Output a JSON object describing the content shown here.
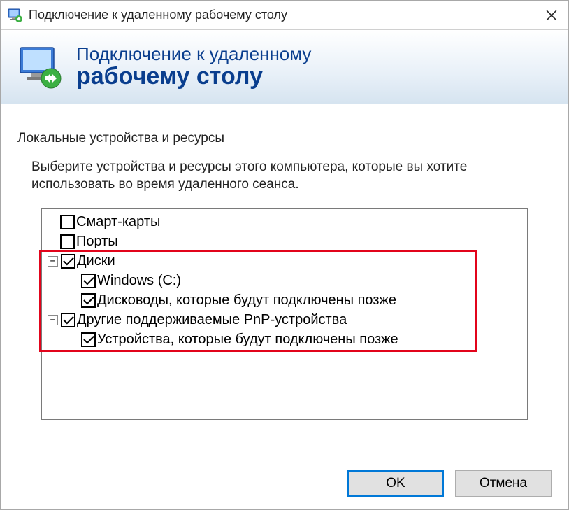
{
  "titlebar": {
    "title": "Подключение к удаленному рабочему столу"
  },
  "banner": {
    "line1": "Подключение к удаленному",
    "line2": "рабочему столу"
  },
  "section": {
    "title": "Локальные устройства и ресурсы",
    "instructions": "Выберите устройства и ресурсы этого компьютера, которые вы хотите использовать во время удаленного сеанса."
  },
  "tree": {
    "smartcards": "Смарт-карты",
    "ports": "Порты",
    "drives": "Диски",
    "windows_c": "Windows (C:)",
    "drives_later": "Дисководы, которые будут подключены позже",
    "pnp": "Другие поддерживаемые PnP-устройства",
    "pnp_later": "Устройства, которые будут подключены позже"
  },
  "buttons": {
    "ok": "OK",
    "cancel": "Отмена"
  }
}
